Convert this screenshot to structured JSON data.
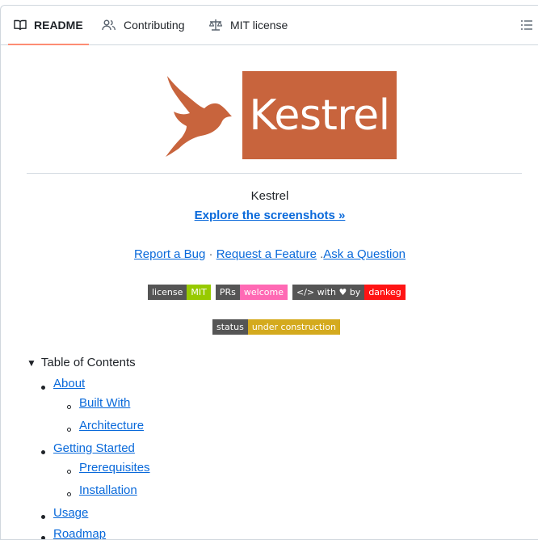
{
  "tabs": [
    {
      "label": "README",
      "icon": "book-icon",
      "active": true
    },
    {
      "label": "Contributing",
      "icon": "people-icon"
    },
    {
      "label": "MIT license",
      "icon": "law-scale-icon"
    }
  ],
  "toolbar": {
    "toc_icon": "list-unordered-icon"
  },
  "logo": {
    "text": "Kestrel",
    "bg_color": "#c8643d"
  },
  "project_name": "Kestrel",
  "explore_link": "Explore the screenshots »",
  "links": {
    "bug": "Report a Bug",
    "sep1": "·",
    "feature": "Request a Feature",
    "sep2": ".",
    "question": "Ask a Question"
  },
  "badges": [
    {
      "left": "license",
      "right": "MIT",
      "color": "#97ca00"
    },
    {
      "left": "PRs",
      "right": "welcome",
      "color": "#ff69b4"
    },
    {
      "left": "</> with ♥ by",
      "right": "dankeg",
      "color": "#ff1414"
    }
  ],
  "status_badge": {
    "left": "status",
    "right": "under construction",
    "color": "#d4aa1e"
  },
  "toc": {
    "summary": "Table of Contents",
    "items": [
      {
        "label": "About",
        "children": [
          "Built With",
          "Architecture"
        ]
      },
      {
        "label": "Getting Started",
        "children": [
          "Prerequisites",
          "Installation"
        ]
      },
      {
        "label": "Usage",
        "children": []
      },
      {
        "label": "Roadmap",
        "children": []
      }
    ]
  }
}
